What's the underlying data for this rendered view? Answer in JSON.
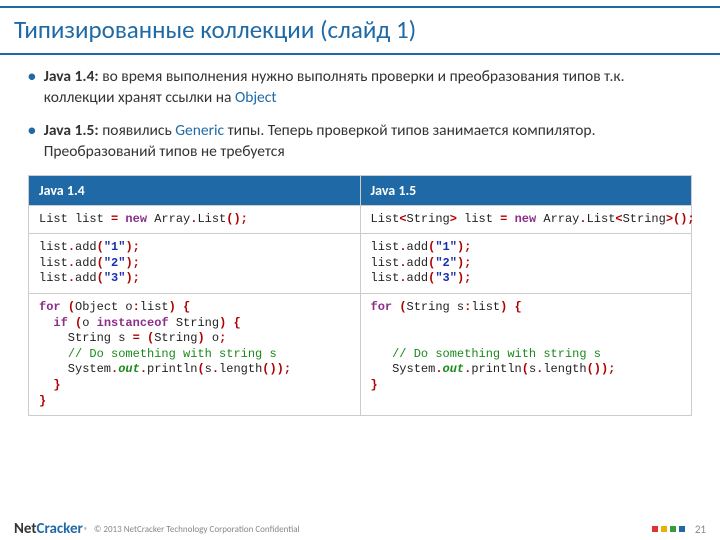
{
  "title": "Типизированные коллекции (слайд 1)",
  "bullets": [
    {
      "prefix": "Java 1.4:",
      "text_before": " во время выполнения нужно выполнять проверки и преобразования типов т.к. коллекции хранят ссылки на ",
      "kw": "Object",
      "text_after": ""
    },
    {
      "prefix": "Java 1.5:",
      "text_before": " появились ",
      "kw": "Generic",
      "text_after": " типы. Теперь проверкой типов занимается компилятор. Преобразований типов не требуется"
    }
  ],
  "table": {
    "headers": [
      "Java 1.4",
      "Java 1.5"
    ],
    "row1": {
      "c14": [
        [
          "plain",
          "List list "
        ],
        [
          "delim",
          "="
        ],
        [
          "plain",
          " "
        ],
        [
          "kw",
          "new"
        ],
        [
          "plain",
          " Array"
        ],
        [
          "delim",
          "."
        ],
        [
          "plain",
          "List"
        ],
        [
          "delim",
          "();"
        ]
      ],
      "c15": [
        [
          "plain",
          "List"
        ],
        [
          "delim",
          "<"
        ],
        [
          "plain",
          "String"
        ],
        [
          "delim",
          ">"
        ],
        [
          "plain",
          " list "
        ],
        [
          "delim",
          "="
        ],
        [
          "plain",
          " "
        ],
        [
          "kw",
          "new"
        ],
        [
          "plain",
          " Array"
        ],
        [
          "delim",
          "."
        ],
        [
          "plain",
          "List"
        ],
        [
          "delim",
          "<"
        ],
        [
          "plain",
          "String"
        ],
        [
          "delim",
          ">();"
        ]
      ]
    },
    "row2": {
      "lines": [
        [
          [
            "plain",
            "list"
          ],
          [
            "delim",
            "."
          ],
          [
            "plain",
            "add"
          ],
          [
            "delim",
            "("
          ],
          [
            "str",
            "\"1\""
          ],
          [
            "delim",
            ");"
          ]
        ],
        [
          [
            "plain",
            "list"
          ],
          [
            "delim",
            "."
          ],
          [
            "plain",
            "add"
          ],
          [
            "delim",
            "("
          ],
          [
            "str",
            "\"2\""
          ],
          [
            "delim",
            ");"
          ]
        ],
        [
          [
            "plain",
            "list"
          ],
          [
            "delim",
            "."
          ],
          [
            "plain",
            "add"
          ],
          [
            "delim",
            "("
          ],
          [
            "str",
            "\"3\""
          ],
          [
            "delim",
            ");"
          ]
        ]
      ]
    },
    "row3": {
      "c14": [
        [
          [
            "kw",
            "for"
          ],
          [
            "plain",
            " "
          ],
          [
            "delim",
            "("
          ],
          [
            "plain",
            "Object o"
          ],
          [
            "delim",
            ":"
          ],
          [
            "plain",
            "list"
          ],
          [
            "delim",
            ")"
          ],
          [
            "plain",
            " "
          ],
          [
            "delim",
            "{"
          ]
        ],
        [
          [
            "plain",
            "  "
          ],
          [
            "kw",
            "if"
          ],
          [
            "plain",
            " "
          ],
          [
            "delim",
            "("
          ],
          [
            "plain",
            "o "
          ],
          [
            "kw",
            "instanceof"
          ],
          [
            "plain",
            " String"
          ],
          [
            "delim",
            ")"
          ],
          [
            "plain",
            " "
          ],
          [
            "delim",
            "{"
          ]
        ],
        [
          [
            "plain",
            "    String s "
          ],
          [
            "delim",
            "="
          ],
          [
            "plain",
            " "
          ],
          [
            "delim",
            "("
          ],
          [
            "plain",
            "String"
          ],
          [
            "delim",
            ")"
          ],
          [
            "plain",
            " o"
          ],
          [
            "delim",
            ";"
          ]
        ],
        [
          [
            "plain",
            "    "
          ],
          [
            "com",
            "// Do something with string s"
          ]
        ],
        [
          [
            "plain",
            "    System"
          ],
          [
            "delim",
            "."
          ],
          [
            "lit",
            "out"
          ],
          [
            "delim",
            "."
          ],
          [
            "plain",
            "println"
          ],
          [
            "delim",
            "("
          ],
          [
            "plain",
            "s"
          ],
          [
            "delim",
            "."
          ],
          [
            "plain",
            "length"
          ],
          [
            "delim",
            "());"
          ]
        ],
        [
          [
            "plain",
            "  "
          ],
          [
            "delim",
            "}"
          ]
        ],
        [
          [
            "delim",
            "}"
          ]
        ]
      ],
      "c15": [
        [
          [
            "kw",
            "for"
          ],
          [
            "plain",
            " "
          ],
          [
            "delim",
            "("
          ],
          [
            "plain",
            "String s"
          ],
          [
            "delim",
            ":"
          ],
          [
            "plain",
            "list"
          ],
          [
            "delim",
            ")"
          ],
          [
            "plain",
            " "
          ],
          [
            "delim",
            "{"
          ]
        ],
        [
          [
            "plain",
            ""
          ]
        ],
        [
          [
            "plain",
            ""
          ]
        ],
        [
          [
            "plain",
            "   "
          ],
          [
            "com",
            "// Do something with string s"
          ]
        ],
        [
          [
            "plain",
            "   System"
          ],
          [
            "delim",
            "."
          ],
          [
            "lit",
            "out"
          ],
          [
            "delim",
            "."
          ],
          [
            "plain",
            "println"
          ],
          [
            "delim",
            "("
          ],
          [
            "plain",
            "s"
          ],
          [
            "delim",
            "."
          ],
          [
            "plain",
            "length"
          ],
          [
            "delim",
            "());"
          ]
        ],
        [
          [
            "delim",
            "}"
          ]
        ]
      ]
    }
  },
  "footer": {
    "logo_net": "Net",
    "logo_cracker": "Cracker",
    "reg": "®",
    "copyright": "© 2013 NetCracker Technology Corporation Confidential",
    "pagenum": "21"
  }
}
